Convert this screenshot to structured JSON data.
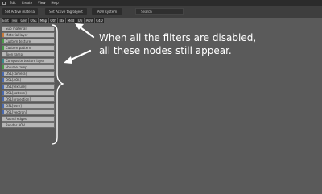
{
  "menubar": {
    "items": [
      "Edit",
      "Create",
      "View",
      "Help"
    ]
  },
  "toolbar": {
    "set_active_material": "Set Active material",
    "set_active_tag_object": "Set Active tag/object",
    "aov_system": "AOV system",
    "search_label": "Search"
  },
  "tabs": [
    "Edit",
    "Tex",
    "Gen",
    "OSL",
    "Map",
    "Oth",
    "Idx",
    "Med",
    "Uti",
    "AOV",
    "C4D"
  ],
  "nodes": [
    {
      "label": "Sub material",
      "color": ""
    },
    {
      "label": "Material layer",
      "color": "#c87a3a"
    },
    {
      "label": "Custom texture",
      "color": "#4a9a4a"
    },
    {
      "label": "Custom pattern",
      "color": "#4a9a4a"
    },
    {
      "label": "Toon ramp",
      "color": ""
    },
    {
      "label": "Composite texture layer",
      "color": "#3a8a8a"
    },
    {
      "label": "Volume ramp",
      "color": "#4a9a4a"
    },
    {
      "label": "OSL[camera]",
      "color": "#4a6ab0"
    },
    {
      "label": "OSL[AOL]",
      "color": "#4a6ab0"
    },
    {
      "label": "OSL[texture]",
      "color": "#4a6ab0"
    },
    {
      "label": "OSL[pattern]",
      "color": "#4a6ab0"
    },
    {
      "label": "OSL[projection]",
      "color": "#4a6ab0"
    },
    {
      "label": "OSL[uvm]",
      "color": "#4a6ab0"
    },
    {
      "label": "OSL[vectron]",
      "color": "#4a6ab0"
    },
    {
      "label": "Round edges",
      "color": ""
    },
    {
      "label": "Render AOV",
      "color": ""
    }
  ],
  "annotation": {
    "line1": "When all the filters are disabled,",
    "line2": "all these nodes still appear."
  }
}
